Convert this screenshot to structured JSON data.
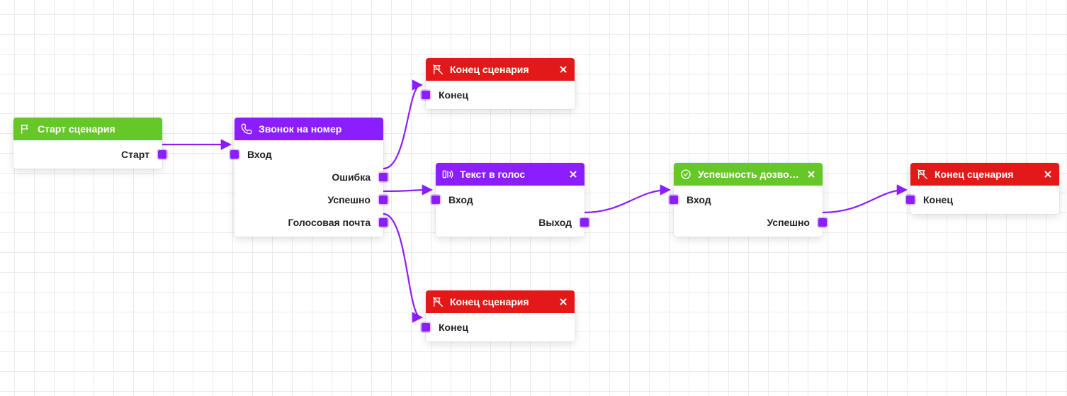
{
  "colors": {
    "green": "#65c728",
    "purple": "#8c1dff",
    "red": "#e31818",
    "connector": "#8c1dff"
  },
  "nodes": {
    "start": {
      "title": "Старт сценария",
      "ports": {
        "out0": "Старт"
      }
    },
    "call": {
      "title": "Звонок на номер",
      "ports": {
        "in0": "Вход",
        "out0": "Ошибка",
        "out1": "Успешно",
        "out2": "Голосовая почта"
      }
    },
    "end1": {
      "title": "Конец сценария",
      "ports": {
        "in0": "Конец"
      }
    },
    "tts": {
      "title": "Текст в голос",
      "ports": {
        "in0": "Вход",
        "out0": "Выход"
      }
    },
    "end2": {
      "title": "Конец сценария",
      "ports": {
        "in0": "Конец"
      }
    },
    "success": {
      "title": "Успешность дозвона",
      "ports": {
        "in0": "Вход",
        "out0": "Успешно"
      }
    },
    "end3": {
      "title": "Конец сценария",
      "ports": {
        "in0": "Конец"
      }
    }
  }
}
